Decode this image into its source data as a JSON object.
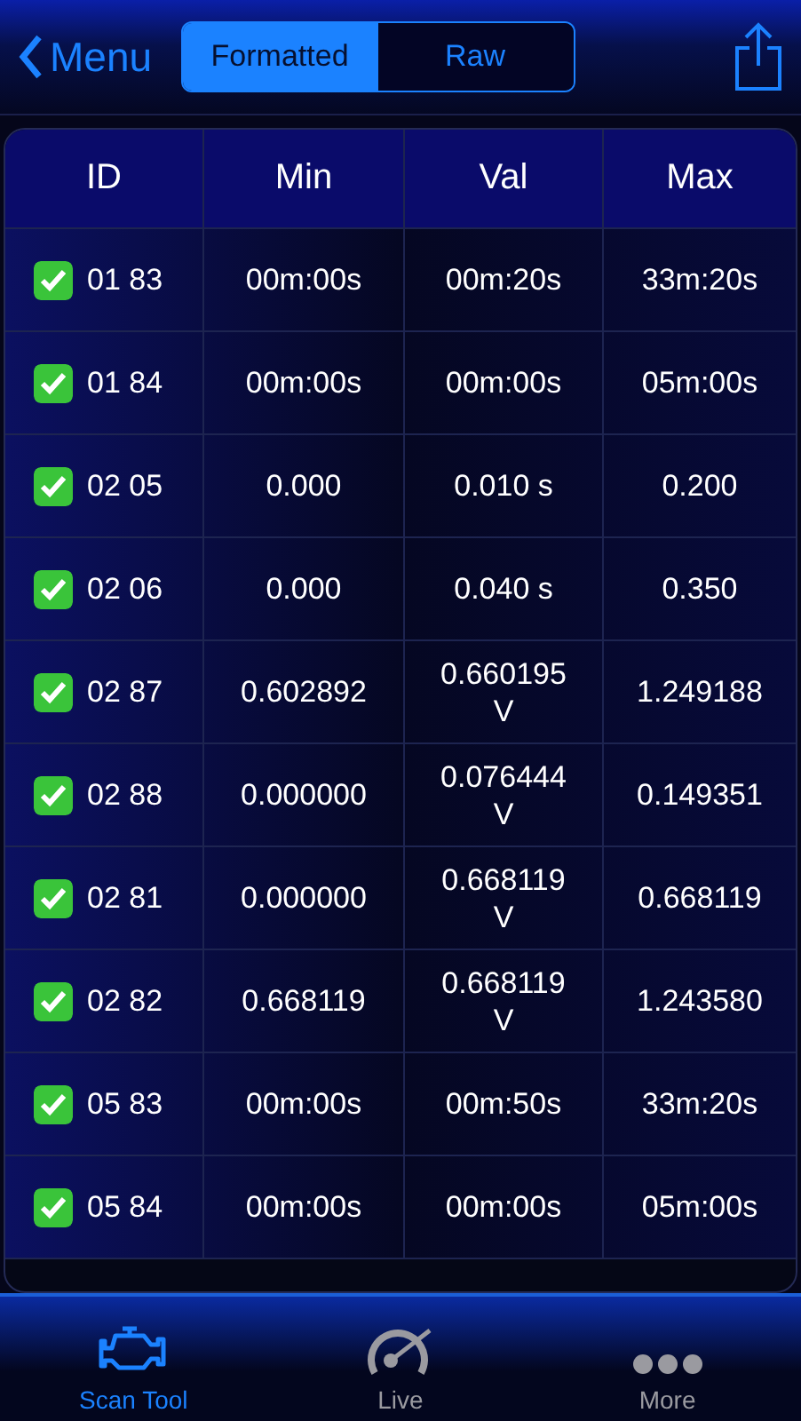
{
  "nav": {
    "back_label": "Menu",
    "segments": [
      {
        "label": "Formatted",
        "selected": true
      },
      {
        "label": "Raw",
        "selected": false
      }
    ]
  },
  "table": {
    "columns": [
      "ID",
      "Min",
      "Val",
      "Max"
    ],
    "rows": [
      {
        "checked": true,
        "id": "01 83",
        "min": "00m:00s",
        "val": "00m:20s",
        "max": "33m:20s"
      },
      {
        "checked": true,
        "id": "01 84",
        "min": "00m:00s",
        "val": "00m:00s",
        "max": "05m:00s"
      },
      {
        "checked": true,
        "id": "02 05",
        "min": "0.000",
        "val": "0.010 s",
        "max": "0.200"
      },
      {
        "checked": true,
        "id": "02 06",
        "min": "0.000",
        "val": "0.040 s",
        "max": "0.350"
      },
      {
        "checked": true,
        "id": "02 87",
        "min": "0.602892",
        "val": "0.660195 V",
        "max": "1.249188"
      },
      {
        "checked": true,
        "id": "02 88",
        "min": "0.000000",
        "val": "0.076444 V",
        "max": "0.149351"
      },
      {
        "checked": true,
        "id": "02 81",
        "min": "0.000000",
        "val": "0.668119 V",
        "max": "0.668119"
      },
      {
        "checked": true,
        "id": "02 82",
        "min": "0.668119",
        "val": "0.668119 V",
        "max": "1.243580"
      },
      {
        "checked": true,
        "id": "05 83",
        "min": "00m:00s",
        "val": "00m:50s",
        "max": "33m:20s"
      },
      {
        "checked": true,
        "id": "05 84",
        "min": "00m:00s",
        "val": "00m:00s",
        "max": "05m:00s"
      }
    ]
  },
  "tab_bar": [
    {
      "kind": "engine",
      "label": "Scan Tool",
      "selected": true
    },
    {
      "kind": "gauge",
      "label": "Live",
      "selected": false
    },
    {
      "kind": "dots",
      "label": "More",
      "selected": false
    }
  ]
}
